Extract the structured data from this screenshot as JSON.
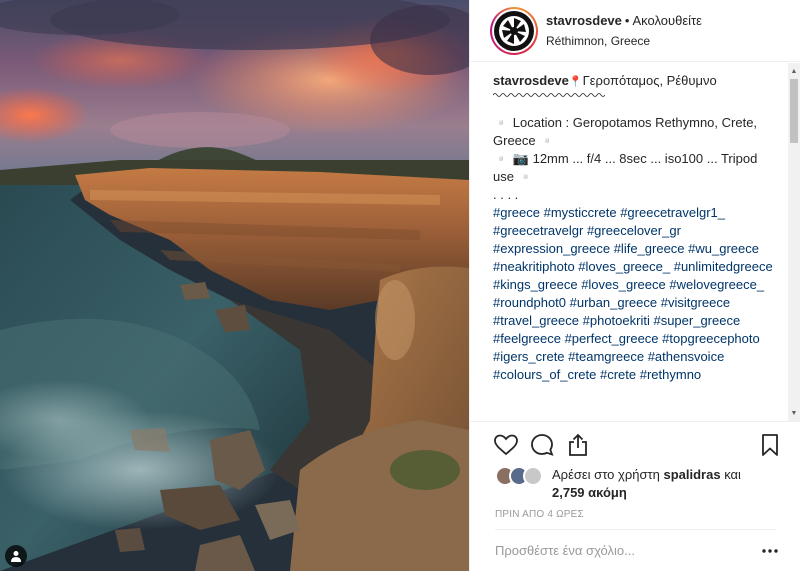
{
  "post": {
    "username": "stavrosdeve",
    "separator": "•",
    "follow_label": "Ακολουθείτε",
    "location": "Réthimnon, Greece"
  },
  "caption": {
    "username": "stavrosdeve",
    "pin_emoji": "📍",
    "place": "Γεροπόταμος, Ρέθυμνο",
    "line1": "▫️ Location : Geropotamos Rethymno, Crete, Greece ▫️",
    "line2": "▫️ 📷 12mm ... f/4 ... 8sec ... iso100 ... Tripod use ▫️",
    "dots": ". . . .",
    "hashtags": [
      "#greece",
      "#mysticcrete",
      "#greecetravelgr1_",
      "#greecetravelgr",
      "#greecelover_gr",
      "#expression_greece",
      "#life_greece",
      "#wu_greece",
      "#neakritiphoto",
      "#loves_greece_",
      "#unlimitedgreece",
      "#kings_greece",
      "#loves_greece",
      "#welovegreece_",
      "#roundphot0",
      "#urban_greece",
      "#visitgreece",
      "#travel_greece",
      "#photoekriti",
      "#super_greece",
      "#feelgreece",
      "#perfect_greece",
      "#topgreecephoto",
      "#igers_crete",
      "#teamgreece",
      "#athensvoice",
      "#colours_of_crete",
      "#crete",
      "#rethymno"
    ]
  },
  "likes": {
    "prefix": "Αρέσει στο χρήστη",
    "user": "spalidras",
    "conjunction": "και",
    "count": "2,759 ακόμη"
  },
  "timestamp": "ΠΡΙΝ ΑΠΟ 4 ΩΡΕΣ",
  "comment": {
    "placeholder": "Προσθέστε ένα σχόλιο..."
  },
  "icons": {
    "like": "heart-icon",
    "comment": "comment-icon",
    "share": "share-icon",
    "save": "bookmark-icon",
    "more": "more-dots-icon",
    "tag": "person-tag-icon"
  },
  "colors": {
    "hashtag": "#003569",
    "timestamp": "#999999",
    "border": "#efefef"
  }
}
